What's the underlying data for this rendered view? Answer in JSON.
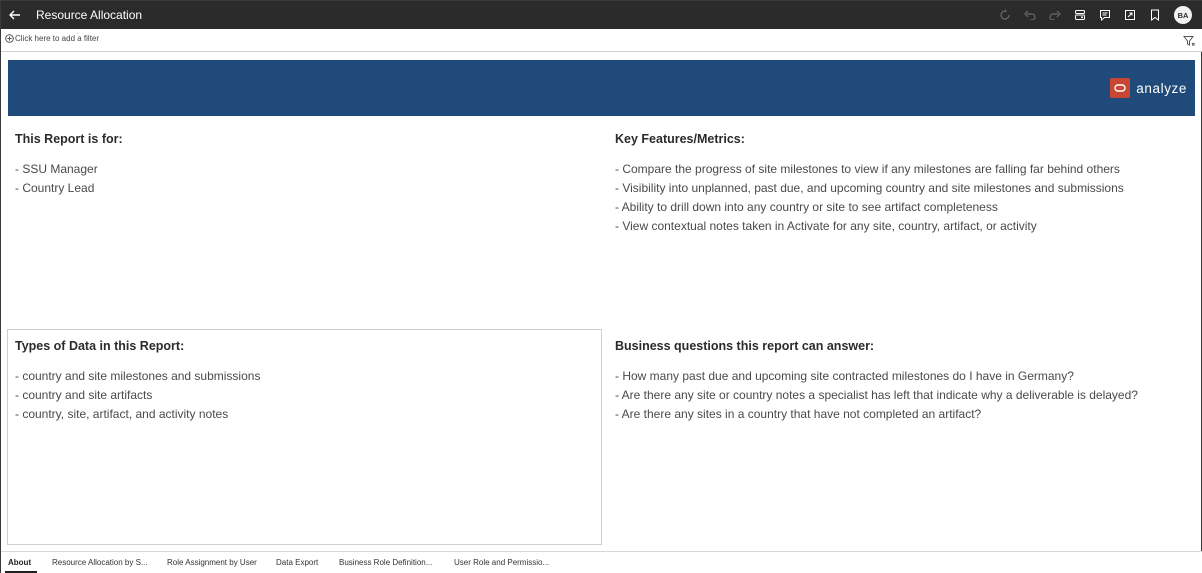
{
  "header": {
    "title": "Resource Allocation",
    "avatar_initials": "BA",
    "icons": [
      "back-arrow-icon",
      "refresh-icon",
      "undo-icon",
      "redo-icon",
      "data-icon",
      "comment-icon",
      "present-icon",
      "bookmark-icon"
    ]
  },
  "filter_bar": {
    "add_filter_label": "Click here to add a filter"
  },
  "banner": {
    "brand_text": "analyze",
    "color": "#1f4a7a",
    "logo_color": "#c74634"
  },
  "sections": {
    "report_for": {
      "heading": "This Report is for:",
      "items": [
        "- SSU Manager",
        "- Country Lead"
      ]
    },
    "key_features": {
      "heading": "Key Features/Metrics:",
      "items": [
        "- Compare the progress of site milestones to view if any milestones are falling far behind others",
        "- Visibility into unplanned, past due, and upcoming country and site milestones and submissions",
        "- Ability to drill down into any country or site to see artifact completeness",
        "- View contextual notes taken in Activate for any site, country, artifact, or activity"
      ]
    },
    "data_types": {
      "heading": "Types of Data in this Report:",
      "items": [
        "- country and site milestones and submissions",
        "- country and site artifacts",
        "- country, site, artifact, and activity notes"
      ]
    },
    "business_questions": {
      "heading": "Business questions this report can answer:",
      "items": [
        "- How many past due and upcoming site contracted milestones do I have in Germany?",
        "- Are there any site or country notes a specialist has left that indicate why a deliverable is delayed?",
        "- Are there any sites in a country that have not completed an artifact?"
      ]
    }
  },
  "tabs": [
    {
      "label": "About",
      "active": true
    },
    {
      "label": "Resource Allocation by S...",
      "active": false
    },
    {
      "label": "Role Assignment by User",
      "active": false
    },
    {
      "label": "Data Export",
      "active": false
    },
    {
      "label": "Business Role Definition...",
      "active": false
    },
    {
      "label": "User Role and Permissio...",
      "active": false
    }
  ]
}
